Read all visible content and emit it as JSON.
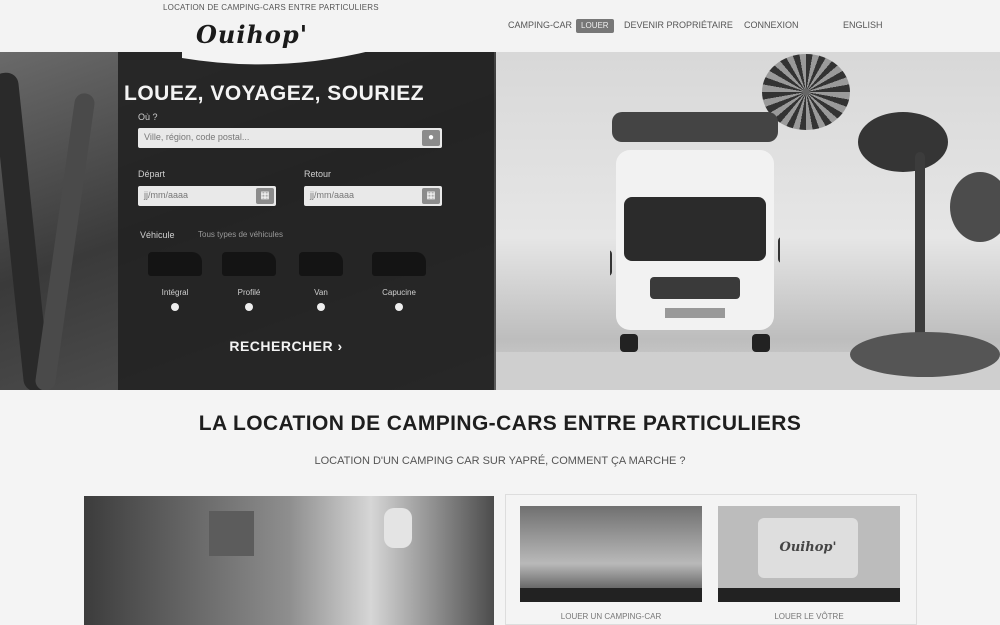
{
  "header": {
    "tagline": "LOCATION DE CAMPING-CARS ENTRE PARTICULIERS",
    "logo_text": "Ouihop'",
    "nav": [
      {
        "label": "CAMPING-CAR",
        "badge": "LOUER"
      },
      {
        "label": "DEVENIR PROPRIÉTAIRE",
        "badge": ""
      },
      {
        "label": "CONNEXION",
        "badge": ""
      },
      {
        "label": "ENGLISH",
        "badge": ""
      }
    ]
  },
  "hero": {
    "title": "LOUEZ, VOYAGEZ, SOURIEZ",
    "where_label": "Où ?",
    "where_placeholder": "Ville, région, code postal...",
    "from_label": "Départ",
    "from_value": "jj/mm/aaaa",
    "to_label": "Retour",
    "to_value": "jj/mm/aaaa",
    "vehicles_label": "Véhicule",
    "vehicles_hint": "Tous types de véhicules",
    "vehicle_types": [
      {
        "name": "Intégral"
      },
      {
        "name": "Profilé"
      },
      {
        "name": "Van"
      },
      {
        "name": "Capucine"
      }
    ],
    "search_label": "RECHERCHER ›"
  },
  "section": {
    "title": "LA LOCATION DE CAMPING-CARS ENTRE PARTICULIERS",
    "subtitle": "LOCATION D'UN CAMPING CAR SUR YAPRÉ, COMMENT ÇA MARCHE ?"
  },
  "cards": [
    {
      "caption": "LOUER UN CAMPING-CAR"
    },
    {
      "caption": "LOUER LE VÔTRE"
    }
  ],
  "colors": {
    "panel": "#232323",
    "text_light": "#f4f4f4",
    "accent": "#777777"
  }
}
